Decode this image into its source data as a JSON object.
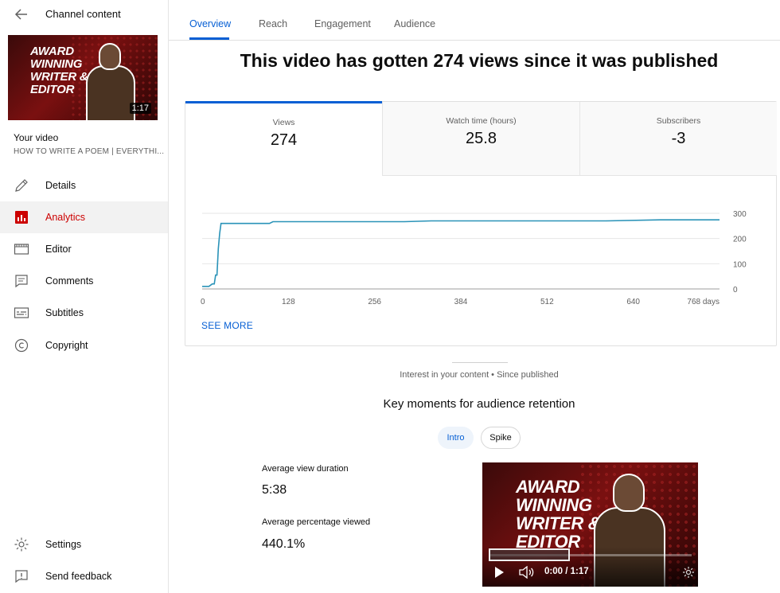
{
  "sidebar": {
    "title": "Channel content",
    "thumbnail": {
      "lines": [
        "AWARD",
        "WINNING",
        "WRITER &",
        "EDITOR"
      ],
      "duration": "1:17"
    },
    "your_video_label": "Your video",
    "video_title": "HOW TO WRITE A POEM | EVERYTHI...",
    "nav": [
      {
        "label": "Details",
        "icon": "pencil-icon"
      },
      {
        "label": "Analytics",
        "icon": "analytics-icon",
        "active": true
      },
      {
        "label": "Editor",
        "icon": "film-icon"
      },
      {
        "label": "Comments",
        "icon": "comment-icon"
      },
      {
        "label": "Subtitles",
        "icon": "subtitles-icon"
      },
      {
        "label": "Copyright",
        "icon": "copyright-icon"
      }
    ],
    "footer": [
      {
        "label": "Settings",
        "icon": "gear-icon"
      },
      {
        "label": "Send feedback",
        "icon": "feedback-icon"
      }
    ]
  },
  "tabs": [
    {
      "label": "Overview",
      "active": true
    },
    {
      "label": "Reach"
    },
    {
      "label": "Engagement"
    },
    {
      "label": "Audience"
    }
  ],
  "headline": "This video has gotten 274 views since it was published",
  "metrics": [
    {
      "label": "Views",
      "value": "274"
    },
    {
      "label": "Watch time (hours)",
      "value": "25.8"
    },
    {
      "label": "Subscribers",
      "value": "-3"
    }
  ],
  "chart_data": {
    "type": "line",
    "title": "",
    "xlabel": "",
    "ylabel": "",
    "xlim": [
      0,
      768
    ],
    "ylim": [
      0,
      300
    ],
    "x_ticks": [
      "0",
      "128",
      "256",
      "384",
      "512",
      "640",
      "768 days"
    ],
    "y_ticks": [
      "0",
      "100",
      "200",
      "300"
    ],
    "grid": true,
    "color": "#2a93b8",
    "series": [
      {
        "x": [
          0,
          10,
          15,
          18,
          20,
          22,
          24,
          26,
          28,
          35,
          100,
          105,
          300,
          340,
          600,
          680,
          768
        ],
        "y": [
          10,
          10,
          20,
          20,
          55,
          55,
          160,
          220,
          260,
          260,
          260,
          267,
          267,
          270,
          270,
          274,
          274
        ]
      }
    ]
  },
  "see_more": "SEE MORE",
  "interest_caption": "Interest in your content • Since published",
  "key_moments_title": "Key moments for audience retention",
  "chips": {
    "intro": "Intro",
    "spike": "Spike"
  },
  "stats": {
    "avg_duration_label": "Average view duration",
    "avg_duration_value": "5:38",
    "avg_percent_label": "Average percentage viewed",
    "avg_percent_value": "440.1%"
  },
  "player": {
    "lines": [
      "AWARD",
      "WINNING",
      "WRITER &",
      "EDITOR"
    ],
    "time": "0:00 / 1:17"
  }
}
